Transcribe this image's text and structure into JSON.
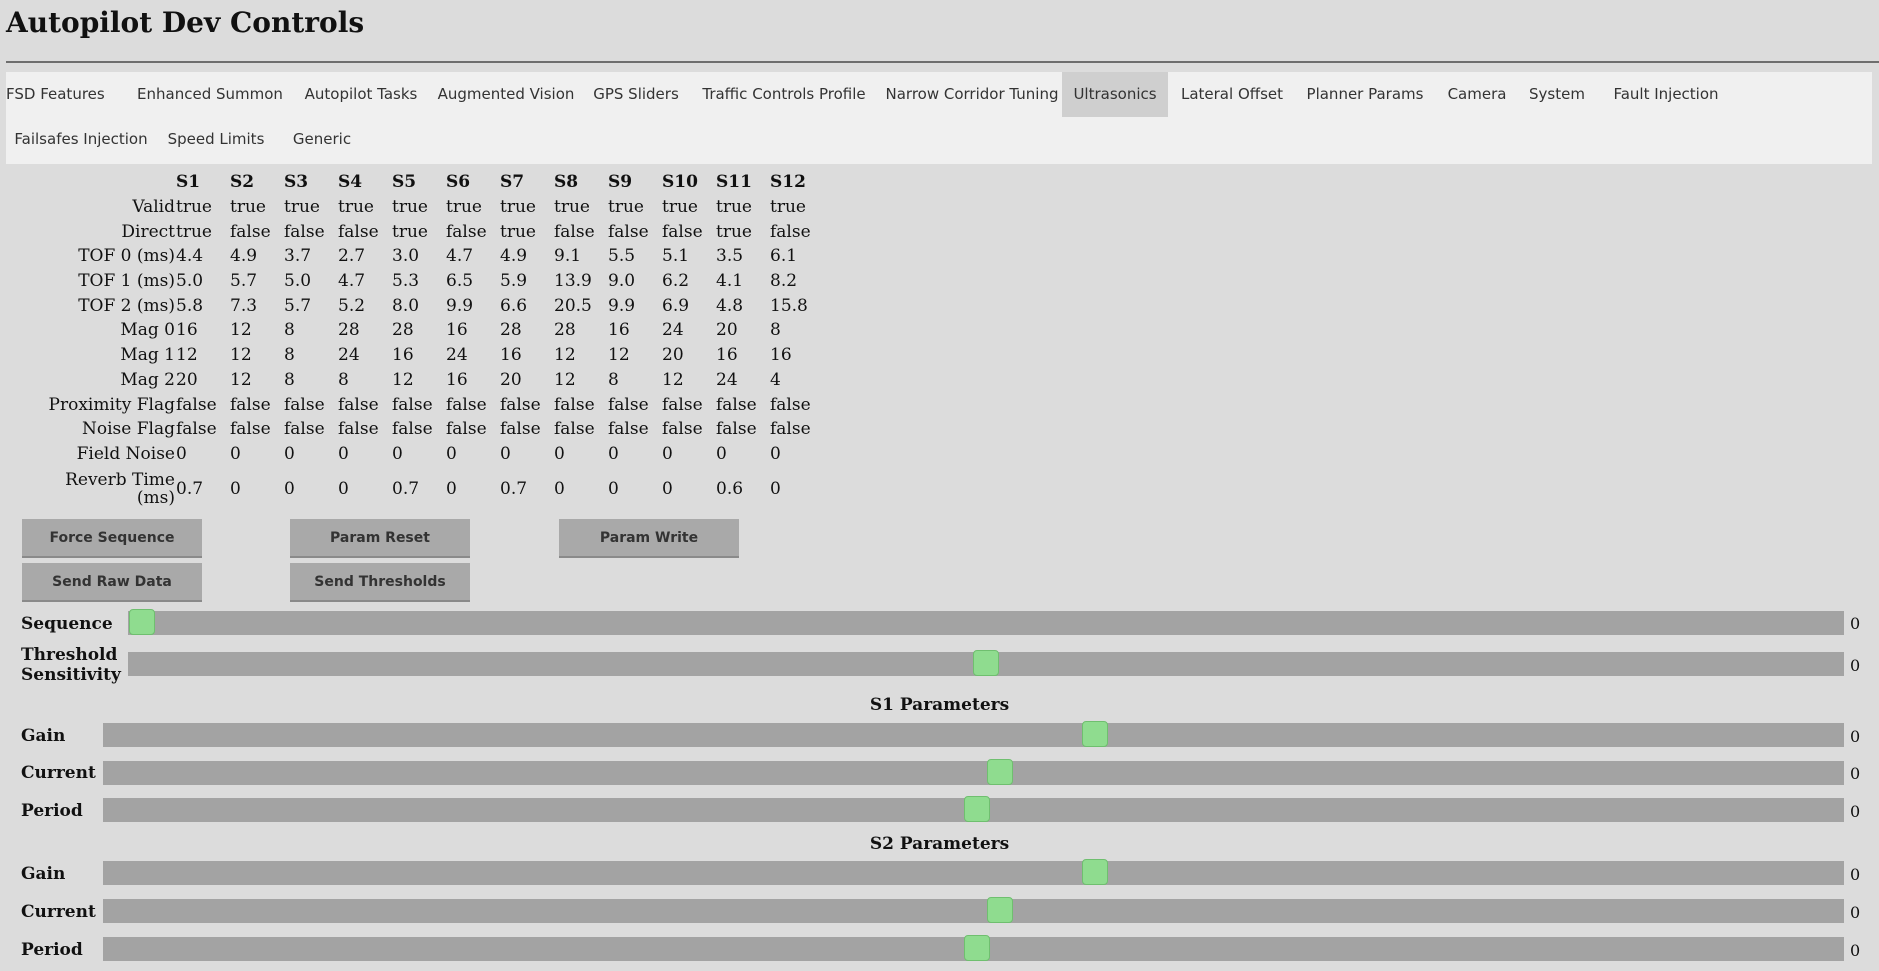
{
  "title": "Autopilot Dev Controls",
  "tabs": [
    "FSD Features",
    "Enhanced Summon",
    "Autopilot Tasks",
    "Augmented Vision",
    "GPS Sliders",
    "Traffic Controls Profile",
    "Narrow Corridor Tuning",
    "Ultrasonics",
    "Lateral Offset",
    "Planner Params",
    "Camera",
    "System",
    "Fault Injection",
    "Failsafes Injection",
    "Speed Limits",
    "Generic"
  ],
  "active_tab": "Ultrasonics",
  "table": {
    "columns": [
      "S1",
      "S2",
      "S3",
      "S4",
      "S5",
      "S6",
      "S7",
      "S8",
      "S9",
      "S10",
      "S11",
      "S12"
    ],
    "rows": [
      {
        "label": "Valid",
        "values": [
          "true",
          "true",
          "true",
          "true",
          "true",
          "true",
          "true",
          "true",
          "true",
          "true",
          "true",
          "true"
        ]
      },
      {
        "label": "Direct",
        "values": [
          "true",
          "false",
          "false",
          "false",
          "true",
          "false",
          "true",
          "false",
          "false",
          "false",
          "true",
          "false"
        ]
      },
      {
        "label": "TOF 0 (ms)",
        "values": [
          "4.4",
          "4.9",
          "3.7",
          "2.7",
          "3.0",
          "4.7",
          "4.9",
          "9.1",
          "5.5",
          "5.1",
          "3.5",
          "6.1"
        ]
      },
      {
        "label": "TOF 1 (ms)",
        "values": [
          "5.0",
          "5.7",
          "5.0",
          "4.7",
          "5.3",
          "6.5",
          "5.9",
          "13.9",
          "9.0",
          "6.2",
          "4.1",
          "8.2"
        ]
      },
      {
        "label": "TOF 2 (ms)",
        "values": [
          "5.8",
          "7.3",
          "5.7",
          "5.2",
          "8.0",
          "9.9",
          "6.6",
          "20.5",
          "9.9",
          "6.9",
          "4.8",
          "15.8"
        ]
      },
      {
        "label": "Mag 0",
        "values": [
          "16",
          "12",
          "8",
          "28",
          "28",
          "16",
          "28",
          "28",
          "16",
          "24",
          "20",
          "8"
        ]
      },
      {
        "label": "Mag 1",
        "values": [
          "12",
          "12",
          "8",
          "24",
          "16",
          "24",
          "16",
          "12",
          "12",
          "20",
          "16",
          "16"
        ]
      },
      {
        "label": "Mag 2",
        "values": [
          "20",
          "12",
          "8",
          "8",
          "12",
          "16",
          "20",
          "12",
          "8",
          "12",
          "24",
          "4"
        ]
      },
      {
        "label": "Proximity Flag",
        "values": [
          "false",
          "false",
          "false",
          "false",
          "false",
          "false",
          "false",
          "false",
          "false",
          "false",
          "false",
          "false"
        ]
      },
      {
        "label": "Noise Flag",
        "values": [
          "false",
          "false",
          "false",
          "false",
          "false",
          "false",
          "false",
          "false",
          "false",
          "false",
          "false",
          "false"
        ]
      },
      {
        "label": "Field Noise",
        "values": [
          "0",
          "0",
          "0",
          "0",
          "0",
          "0",
          "0",
          "0",
          "0",
          "0",
          "0",
          "0"
        ]
      },
      {
        "label": "Reverb Time (ms)",
        "values": [
          "0.7",
          "0",
          "0",
          "0",
          "0.7",
          "0",
          "0.7",
          "0",
          "0",
          "0",
          "0.6",
          "0"
        ]
      }
    ]
  },
  "buttons": {
    "force_sequence": "Force Sequence",
    "param_reset": "Param Reset",
    "param_write": "Param Write",
    "send_raw_data": "Send Raw Data",
    "send_thresholds": "Send Thresholds"
  },
  "sliders": {
    "sequence": {
      "label": "Sequence",
      "value": "0",
      "fraction": 0.008
    },
    "threshold_sensitivity": {
      "label": "Threshold Sensitivity",
      "value": "0",
      "fraction": 0.5
    },
    "s1_title": "S1 Parameters",
    "s1": [
      {
        "label": "Gain",
        "value": "0",
        "fraction": 0.57
      },
      {
        "label": "Current",
        "value": "0",
        "fraction": 0.515
      },
      {
        "label": "Period",
        "value": "0",
        "fraction": 0.502
      }
    ],
    "s2_title": "S2 Parameters",
    "s2": [
      {
        "label": "Gain",
        "value": "0",
        "fraction": 0.57
      },
      {
        "label": "Current",
        "value": "0",
        "fraction": 0.515
      },
      {
        "label": "Period",
        "value": "0",
        "fraction": 0.502
      }
    ]
  },
  "colors": {
    "accent_thumb": "#8fdc8f",
    "track": "#a3a3a3",
    "active_tab": "#cfcfcf"
  }
}
